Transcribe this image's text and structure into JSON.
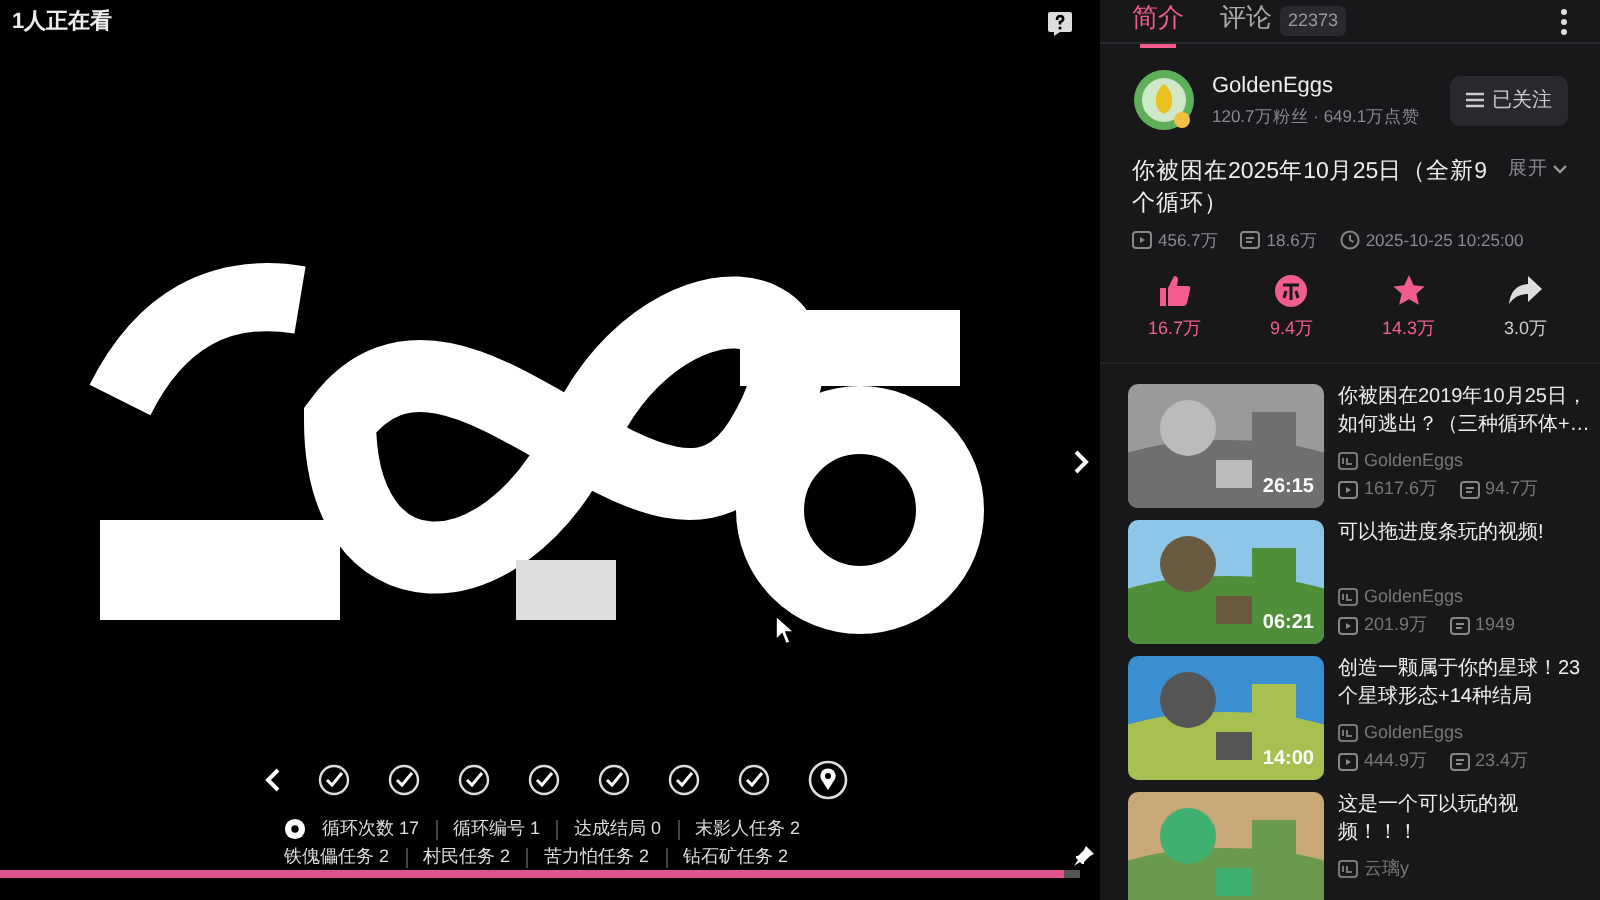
{
  "player": {
    "viewers": "1人正在看",
    "checkpoints": [
      {
        "kind": "done"
      },
      {
        "kind": "done"
      },
      {
        "kind": "done"
      },
      {
        "kind": "done"
      },
      {
        "kind": "done"
      },
      {
        "kind": "done"
      },
      {
        "kind": "done"
      },
      {
        "kind": "current"
      }
    ],
    "stats_row_1": [
      {
        "label": "循环次数",
        "value": "17"
      },
      {
        "label": "循环编号",
        "value": "1"
      },
      {
        "label": "达成结局",
        "value": "0"
      },
      {
        "label": "末影人任务",
        "value": "2"
      }
    ],
    "stats_row_2": [
      {
        "label": "铁傀儡任务",
        "value": "2"
      },
      {
        "label": "村民任务",
        "value": "2"
      },
      {
        "label": "苦力怕任务",
        "value": "2"
      },
      {
        "label": "钻石矿任务",
        "value": "2"
      }
    ],
    "progress": {
      "level": 0.985
    }
  },
  "tabs": [
    {
      "label": "简介",
      "selected": true
    },
    {
      "label": "评论",
      "count": "22373",
      "selected": false
    }
  ],
  "author": {
    "name": "GoldenEggs",
    "meta": "120.7万粉丝 · 649.1万点赞",
    "follow_label": "已关注"
  },
  "video": {
    "title": "你被困在2025年10月25日（全新9个循环）",
    "expand": "展开",
    "views": "456.7万",
    "danmaku": "18.6万",
    "date": "2025-10-25 10:25:00"
  },
  "actions": [
    {
      "kind": "like",
      "count": "16.7万",
      "active": true
    },
    {
      "kind": "coin",
      "count": "9.4万",
      "active": true
    },
    {
      "kind": "favorite",
      "count": "14.3万",
      "active": true
    },
    {
      "kind": "share",
      "count": "3.0万",
      "active": false
    }
  ],
  "recommendations": [
    {
      "title": "你被困在2019年10月25日，如何逃出？（三种循环体+…",
      "duration": "26:15",
      "author": "GoldenEggs",
      "views": "1617.6万",
      "danmaku": "94.7万"
    },
    {
      "title": "可以拖进度条玩的视频!",
      "duration": "06:21",
      "author": "GoldenEggs",
      "views": "201.9万",
      "danmaku": "1949"
    },
    {
      "title": "创造一颗属于你的星球！23个星球形态+14种结局",
      "duration": "14:00",
      "author": "GoldenEggs",
      "views": "444.9万",
      "danmaku": "23.4万"
    },
    {
      "title": "这是一个可以玩的视频！！！",
      "author": "云璃y"
    }
  ]
}
